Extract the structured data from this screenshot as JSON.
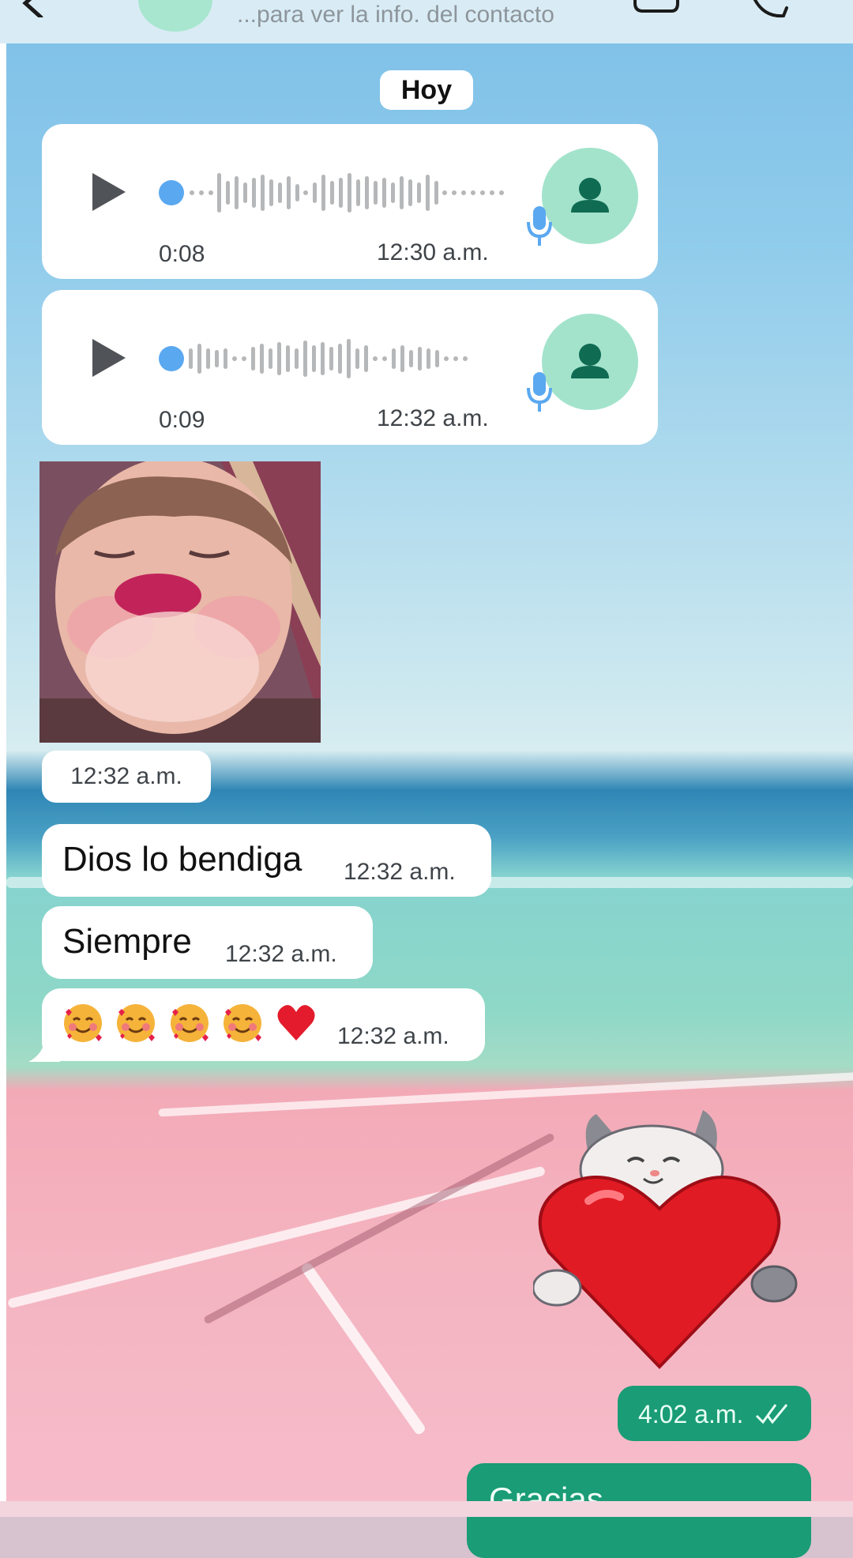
{
  "header": {
    "subtitle": "...para ver la info. del contacto",
    "icons": [
      "back-icon",
      "contact-avatar",
      "video-call-icon",
      "voice-call-icon"
    ]
  },
  "date_chip": "Hoy",
  "voice_messages": [
    {
      "duration": "0:08",
      "time": "12:30 a.m."
    },
    {
      "duration": "0:09",
      "time": "12:32 a.m."
    }
  ],
  "photo_message": {
    "time": "12:32 a.m."
  },
  "text_messages": [
    {
      "text": "Dios lo bendiga",
      "time": "12:32 a.m."
    },
    {
      "text": "Siempre",
      "time": "12:32 a.m."
    },
    {
      "text": "🥰🥰🥰🥰❤️",
      "time": "12:32 a.m."
    }
  ],
  "outgoing": {
    "sticker": "cat-hugging-heart-sticker",
    "sticker_time": "4:02 a.m.",
    "last_message": "Gracias"
  },
  "colors": {
    "outgoing_bubble": "#1a9c76",
    "avatar": "#a3e3cc",
    "play_dot": "#5aa8f0"
  }
}
